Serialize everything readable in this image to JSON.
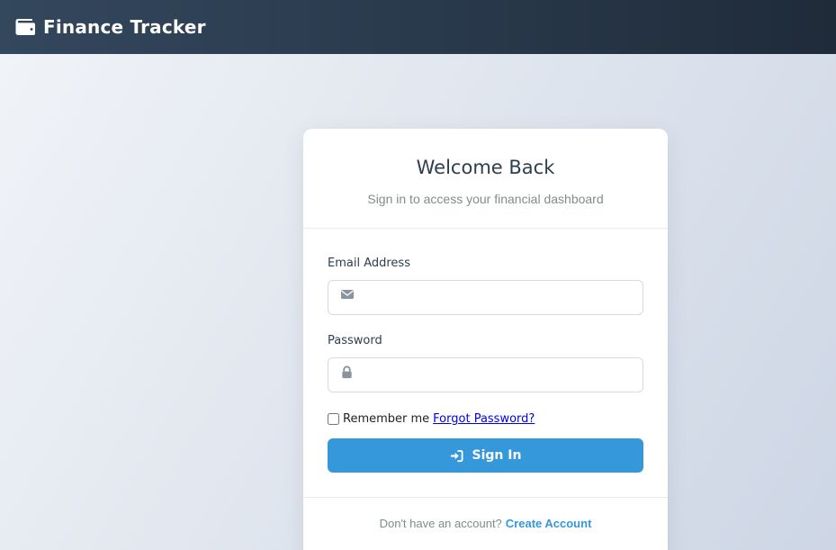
{
  "app": {
    "title": "Finance Tracker",
    "icon": "wallet-icon"
  },
  "login": {
    "title": "Welcome Back",
    "subtitle": "Sign in to access your financial dashboard",
    "email": {
      "label": "Email Address",
      "value": "",
      "placeholder": "",
      "icon": "envelope-icon"
    },
    "password": {
      "label": "Password",
      "value": "",
      "placeholder": "",
      "icon": "lock-icon"
    },
    "remember_label": "Remember me",
    "remember_checked": false,
    "forgot_label": "Forgot Password?",
    "submit_label": "Sign In",
    "submit_icon": "sign-in-icon",
    "footer_text": "Don't have an account?",
    "create_account_label": "Create Account"
  },
  "colors": {
    "header_bg": "#2c3e50",
    "accent": "#3498db",
    "title_text": "#2c3e50",
    "muted_text": "#7f8c8d",
    "link": "#0000ee"
  }
}
